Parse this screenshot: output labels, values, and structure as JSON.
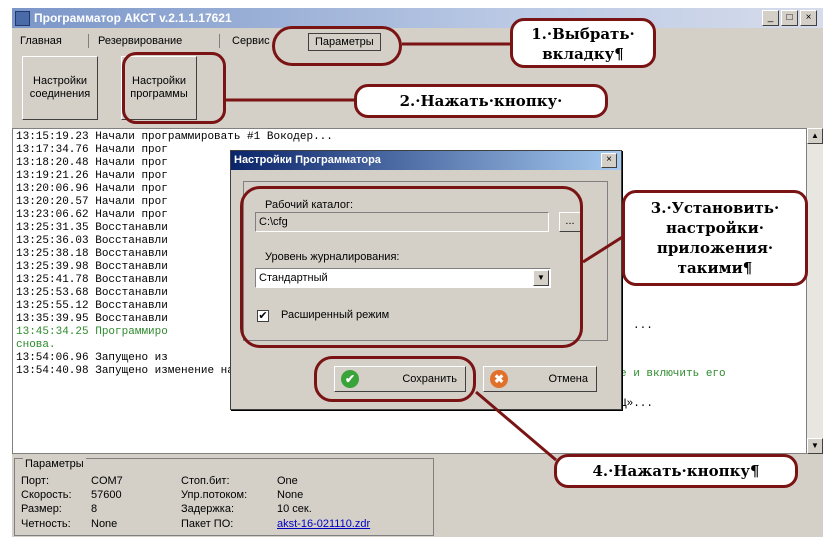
{
  "window": {
    "title": "Программатор АКСТ v.2.1.1.17621",
    "buttons": [
      "_",
      "□",
      "×"
    ]
  },
  "menu": {
    "tabs": [
      "Главная",
      "Резервирование",
      "Сервис",
      "Параметры"
    ]
  },
  "toolbar": {
    "btn1": "Настройки соединения",
    "btn2": "Настройки программы"
  },
  "log": {
    "lines": [
      {
        "time": "13:15:19.23",
        "text": "Начали программировать #1 Вокодер...",
        "green": false
      },
      {
        "time": "13:17:34.76",
        "text": "Начали прог",
        "green": false
      },
      {
        "time": "13:18:20.48",
        "text": "Начали прог",
        "green": false
      },
      {
        "time": "13:19:21.26",
        "text": "Начали прог",
        "green": false
      },
      {
        "time": "13:20:06.96",
        "text": "Начали прог",
        "green": false
      },
      {
        "time": "13:20:20.57",
        "text": "Начали прог",
        "green": false
      },
      {
        "time": "13:23:06.62",
        "text": "Начали прог",
        "green": false
      },
      {
        "time": "13:25:31.35",
        "text": "Восстанавли",
        "green": false
      },
      {
        "time": "13:25:36.03",
        "text": "Восстанавли",
        "green": false
      },
      {
        "time": "13:25:38.18",
        "text": "Восстанавли",
        "green": false
      },
      {
        "time": "13:25:39.98",
        "text": "Восстанавли",
        "green": false
      },
      {
        "time": "13:25:41.78",
        "text": "Восстанавли",
        "green": false
      },
      {
        "time": "13:25:53.68",
        "text": "Восстанавли",
        "green": false
      },
      {
        "time": "13:25:55.12",
        "text": "Восстанавли",
        "green": false
      },
      {
        "time": "13:35:39.95",
        "text": "Восстанавли",
        "green": false
      },
      {
        "time": "13:45:34.25",
        "text": "Программиро",
        "green": true
      },
      {
        "time": "",
        "text": "снова.",
        "green": true
      },
      {
        "time": "13:54:06.96",
        "text": "Запущено из",
        "green": false
      },
      {
        "time": "13:54:40.98",
        "text": "Запущено изменение настроек Программатора АКСТ «Линия Ц»...",
        "green": false
      }
    ],
    "frag_right1": "...",
    "frag_right2": "е и включить его",
    "frag_right3": "Ц»..."
  },
  "status": {
    "caption": "Параметры",
    "port_label": "Порт:",
    "port": "COM7",
    "speed_label": "Скорость:",
    "speed": "57600",
    "size_label": "Размер:",
    "size": "8",
    "parity_label": "Четность:",
    "parity": "None",
    "stop_label": "Стоп.бит:",
    "stop": "One",
    "flow_label": "Упр.потоком:",
    "flow": "None",
    "delay_label": "Задержка:",
    "delay": "10 сек.",
    "pkg_label": "Пакет ПО:",
    "pkg": "akst-16-021110.zdr"
  },
  "dialog": {
    "title": "Настройки Программатора",
    "close": "×",
    "dir_label": "Рабочий каталог:",
    "dir_value": "C:\\cfg",
    "browse": "...",
    "log_label": "Уровень журналирования:",
    "log_value": "Стандартный",
    "ext_label": "Расширенный режим",
    "ext_checked": "✔",
    "save": "Сохранить",
    "cancel": "Отмена"
  },
  "callouts": {
    "c1": "1.·Выбрать· вкладку¶",
    "c2": "2.·Нажать·кнопку·",
    "c3": "3.·Установить· настройки· приложения· такими¶",
    "c4": "4.·Нажать·кнопку¶"
  },
  "colors": {
    "accent": "#7a1414",
    "log_green": "#2e8b2e"
  }
}
